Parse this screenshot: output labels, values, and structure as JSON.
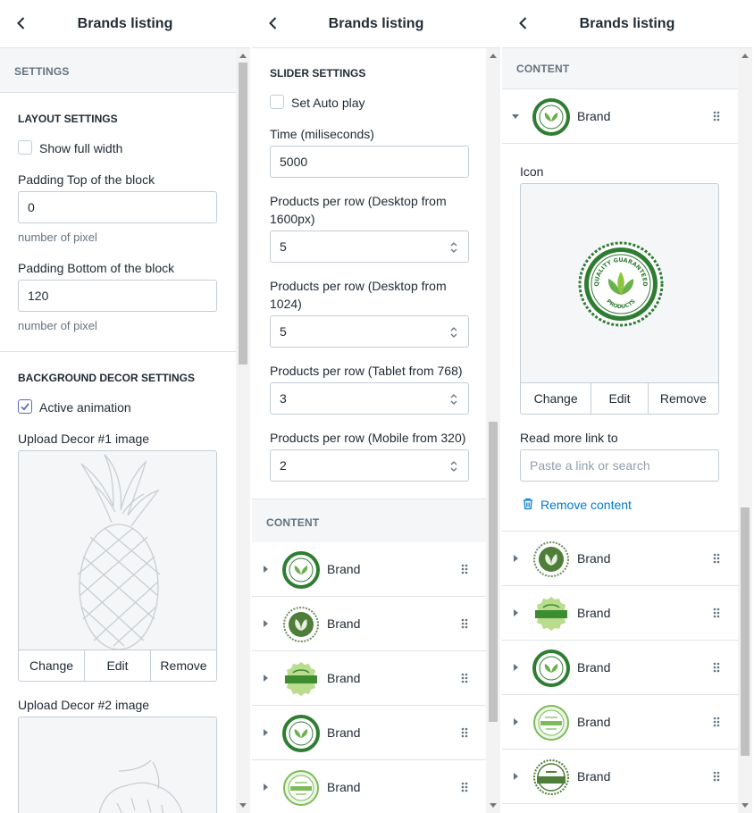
{
  "panel1": {
    "title": "Brands listing",
    "section": "SETTINGS",
    "layout_title": "LAYOUT SETTINGS",
    "show_full_width": "Show full width",
    "padding_top_label": "Padding Top of the block",
    "padding_top_value": "0",
    "padding_top_help": "number of pixel",
    "padding_bottom_label": "Padding Bottom of the block",
    "padding_bottom_value": "120",
    "padding_bottom_help": "number of pixel",
    "bg_title": "BACKGROUND DECOR SETTINGS",
    "active_animation": "Active animation",
    "decor1_label": "Upload Decor #1 image",
    "decor2_label": "Upload Decor #2 image",
    "change": "Change",
    "edit": "Edit",
    "remove": "Remove"
  },
  "panel2": {
    "title": "Brands listing",
    "slider_title": "SLIDER SETTINGS",
    "autoplay": "Set Auto play",
    "time_label": "Time (miliseconds)",
    "time_value": "5000",
    "desktop1600_label_1": "Products per row (Desktop from",
    "desktop1600_label_2": "1600px)",
    "desktop1600_value": "5",
    "desktop1024_label_1": "Products per row (Desktop from",
    "desktop1024_label_2": "1024)",
    "desktop1024_value": "5",
    "tablet_label": "Products per row (Tablet from 768)",
    "tablet_value": "3",
    "mobile_label": "Products per row (Mobile from 320)",
    "mobile_value": "2",
    "content_section": "CONTENT",
    "brands": [
      "Brand",
      "Brand",
      "Brand",
      "Brand",
      "Brand"
    ]
  },
  "panel3": {
    "title": "Brands listing",
    "content_section": "CONTENT",
    "open_brand": "Brand",
    "icon_label": "Icon",
    "badge_top_text": "QUALITY GUARANTEED",
    "badge_bottom_text": "PRODUCTS",
    "change": "Change",
    "edit": "Edit",
    "remove": "Remove",
    "read_more_label": "Read more link to",
    "link_placeholder": "Paste a link or search",
    "remove_content": "Remove content",
    "brands": [
      "Brand",
      "Brand",
      "Brand",
      "Brand",
      "Brand"
    ]
  },
  "colors": {
    "accent": "#5c6ac4",
    "link": "#007ace",
    "border": "#c4cdd5",
    "section_bg": "#f4f6f8",
    "brand_green": "#2f7d32"
  }
}
